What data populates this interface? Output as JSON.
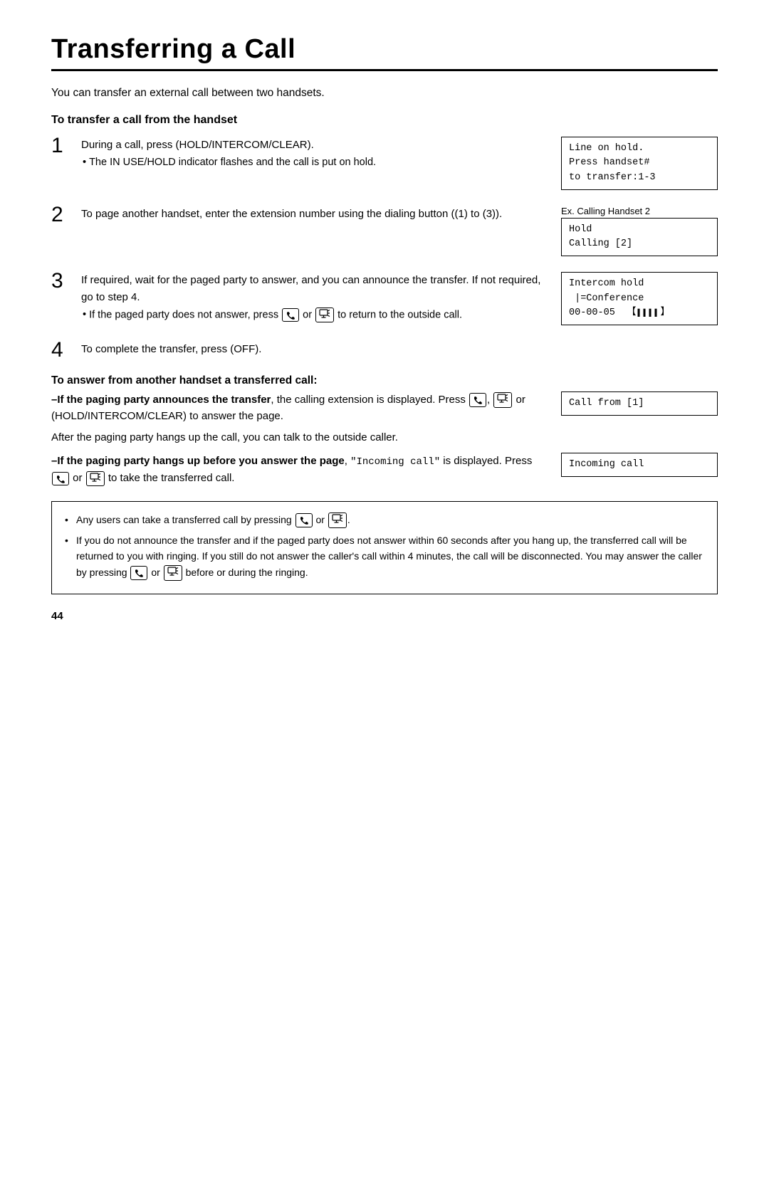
{
  "page": {
    "title": "Transferring a Call",
    "page_number": "44",
    "intro": "You can transfer an external call between two handsets.",
    "section1": {
      "heading": "To transfer a call from the handset",
      "steps": [
        {
          "number": "1",
          "main": "During a call, press (HOLD/INTERCOM/CLEAR).",
          "bullets": [
            "The IN USE/HOLD indicator flashes and the call is put on hold."
          ],
          "lcd": {
            "show": true,
            "lines": [
              "Line on hold.",
              "Press handset#",
              "to transfer:1-3"
            ]
          },
          "lcd_label": ""
        },
        {
          "number": "2",
          "main": "To page another handset, enter the extension number using the dialing button ((1) to (3)).",
          "bullets": [],
          "lcd": {
            "show": true,
            "lines": [
              "Hold",
              "Calling [2]"
            ]
          },
          "lcd_label": "Ex. Calling Handset 2"
        },
        {
          "number": "3",
          "main": "If required, wait for the paged party to answer, and you can announce the transfer. If not required, go to step 4.",
          "bullets": [
            "If the paged party does not answer, press [PHONE] or [ICOM] to return to the outside call."
          ],
          "lcd": {
            "show": true,
            "lines": [
              "Intercom hold",
              " |=Conference",
              "00-00-05  [████]"
            ]
          },
          "lcd_label": ""
        },
        {
          "number": "4",
          "main": "To complete the transfer, press (OFF).",
          "bullets": [],
          "lcd": {
            "show": false,
            "lines": []
          },
          "lcd_label": ""
        }
      ]
    },
    "section2": {
      "heading": "To answer from another handset a transferred call:",
      "sub1": {
        "dash_heading": "–If the paging party announces the transfer",
        "text": ", the calling extension is displayed. Press [PHONE], [ICOM] or (HOLD/INTERCOM/CLEAR) to answer the page.",
        "bullets": [
          "After the paging party hangs up the call, you can talk to the outside caller."
        ],
        "lcd": {
          "lines": [
            "Call from [1]"
          ]
        }
      },
      "sub2": {
        "dash_heading": "–If the paging party hangs up before you answer the page",
        "mono_text": "\"Incoming call\"",
        "text_after": " is displayed. Press [PHONE] or [ICOM] to take the transferred call.",
        "lcd": {
          "lines": [
            "Incoming call"
          ]
        }
      }
    },
    "note_box": {
      "bullets": [
        "Any users can take a transferred call by pressing [PHONE] or [ICOM].",
        "If you do not announce the transfer and if the paged party does not answer within 60 seconds after you hang up, the transferred call will be returned to you with ringing. If you still do not answer the caller's call within 4 minutes, the call will be disconnected. You may answer the caller by pressing [PHONE] or [ICOM] before or during the ringing."
      ]
    }
  }
}
